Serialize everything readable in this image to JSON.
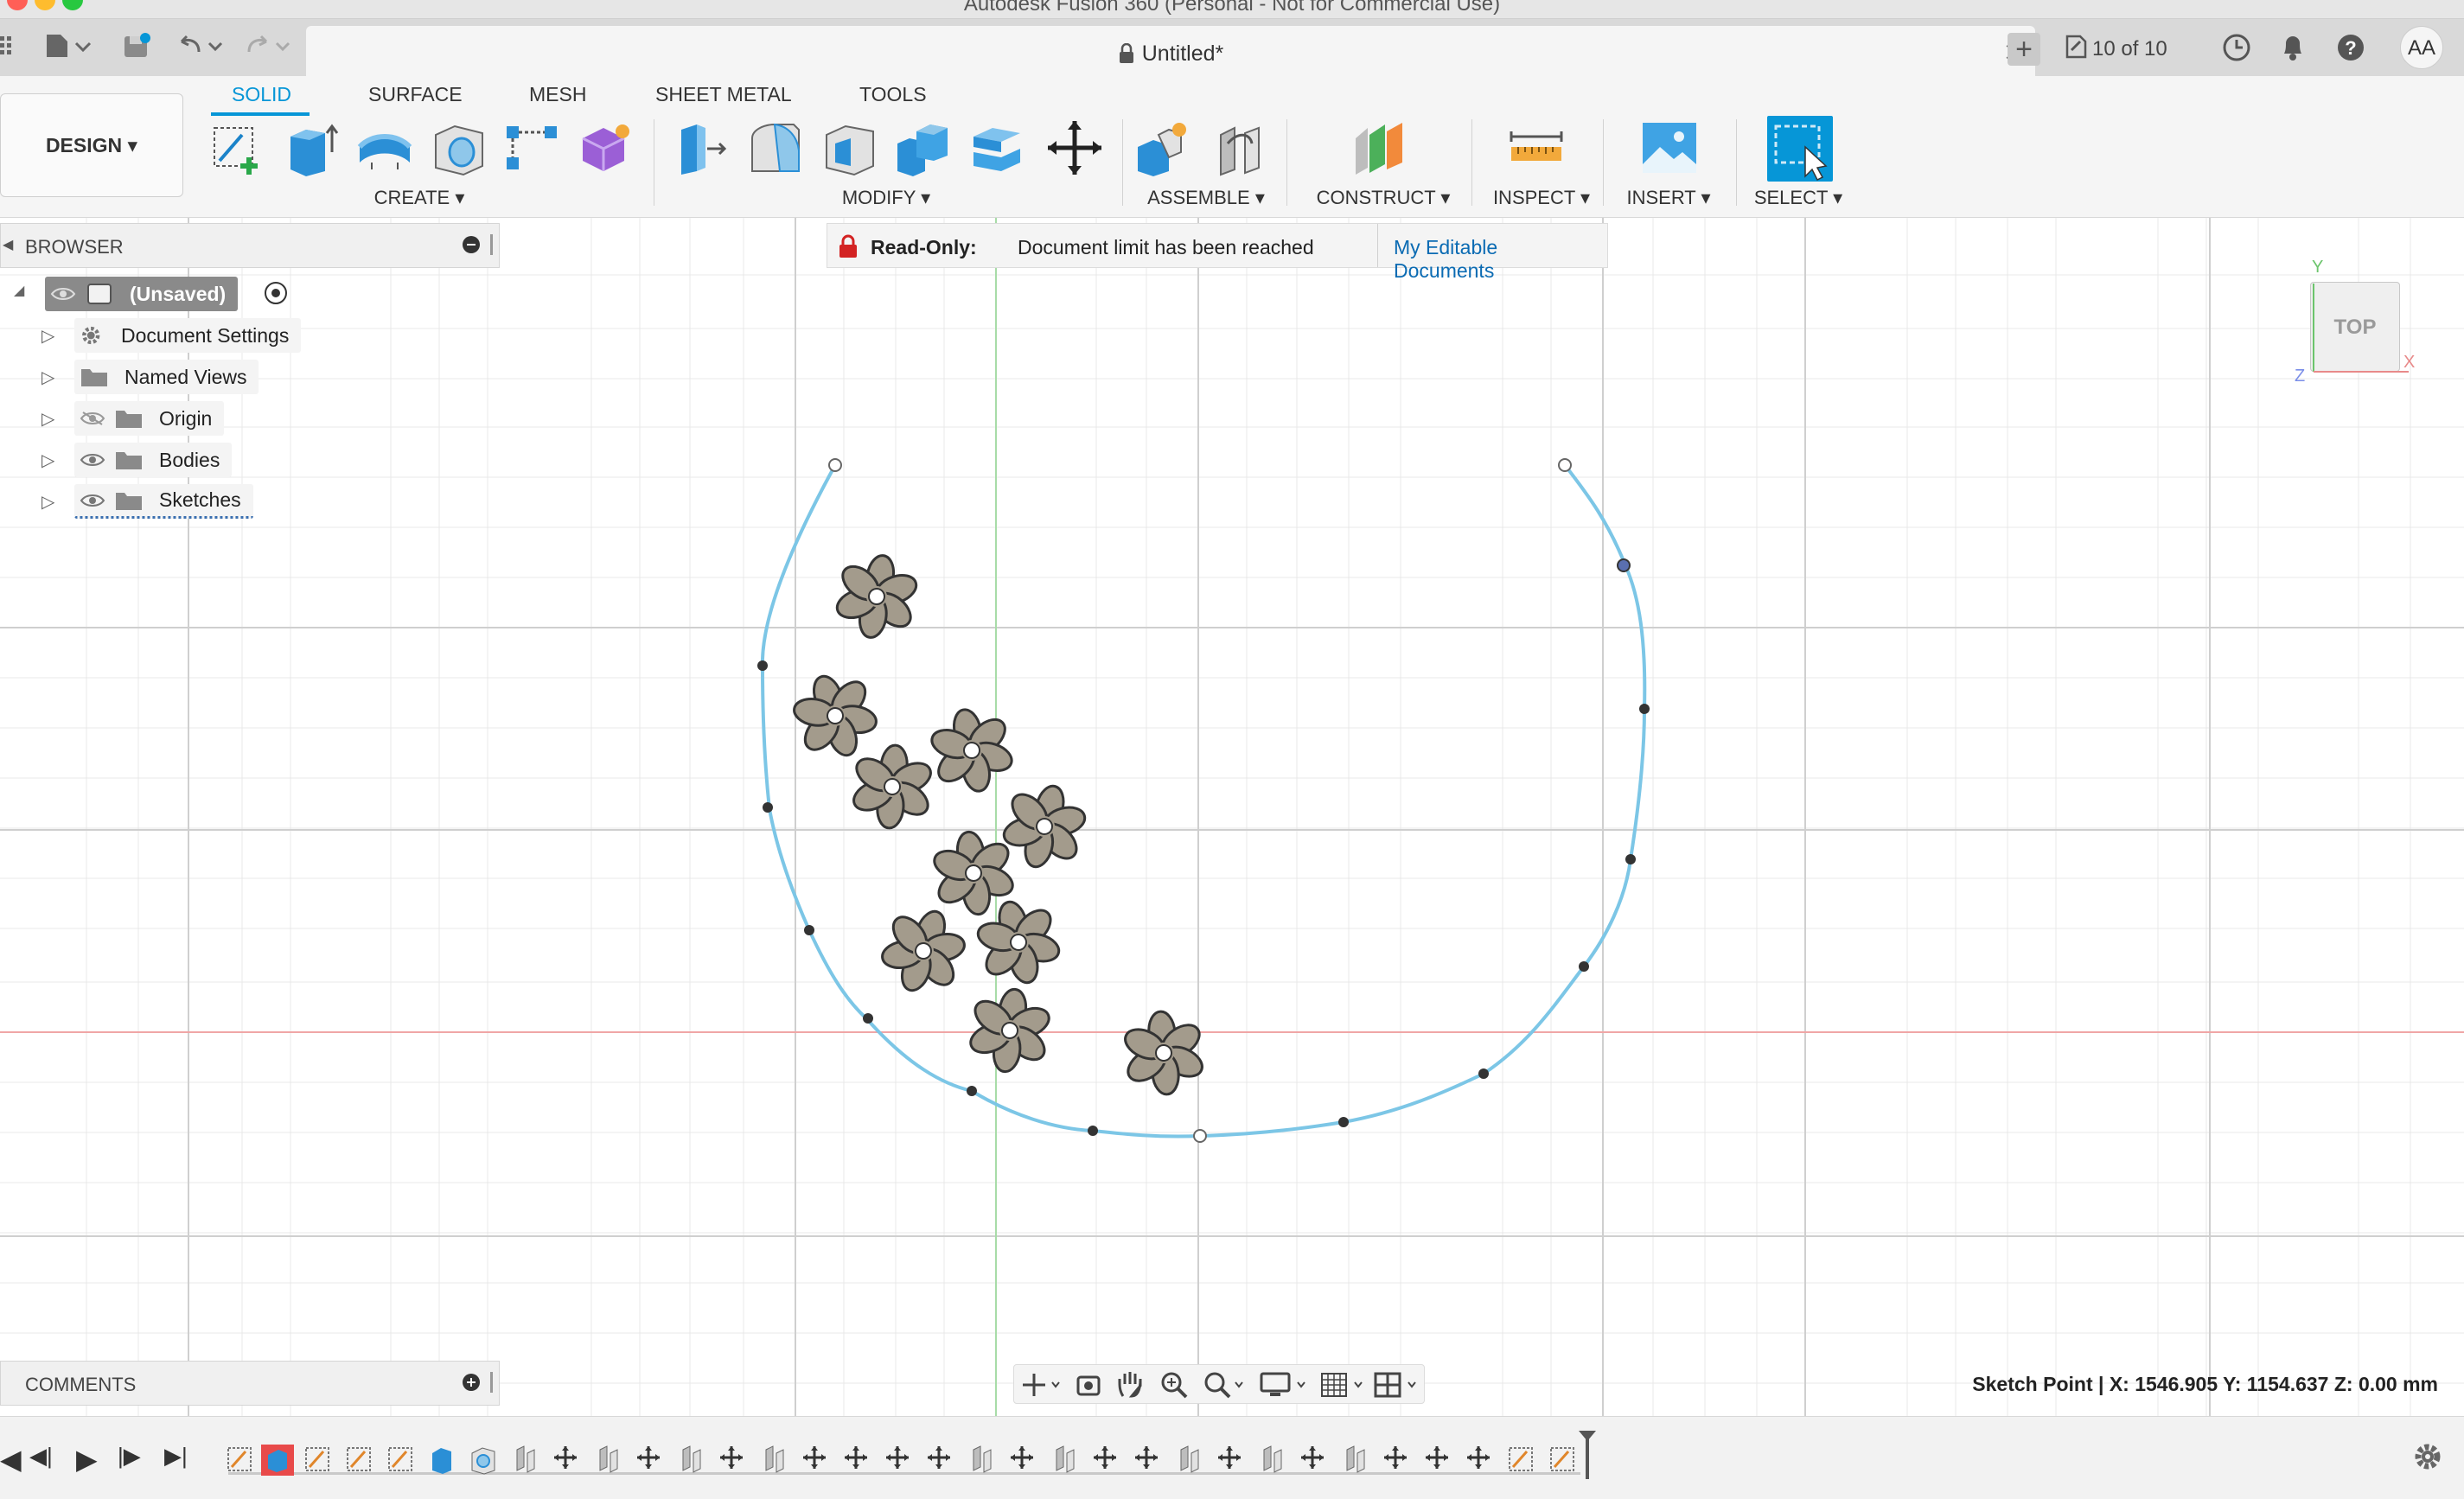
{
  "window": {
    "title": "Autodesk Fusion 360 (Personal - Not for Commercial Use)"
  },
  "tabbar": {
    "doc_title": "Untitled*",
    "job_status": "10 of 10",
    "user_initials": "AA"
  },
  "ribbon": {
    "workspace": "DESIGN ▾",
    "tabs": [
      "SOLID",
      "SURFACE",
      "MESH",
      "SHEET METAL",
      "TOOLS"
    ],
    "groups": [
      "CREATE ▾",
      "MODIFY ▾",
      "ASSEMBLE ▾",
      "CONSTRUCT ▾",
      "INSPECT ▾",
      "INSERT ▾",
      "SELECT ▾"
    ]
  },
  "browser": {
    "header": "BROWSER",
    "root": "(Unsaved)",
    "items": [
      "Document Settings",
      "Named Views",
      "Origin",
      "Bodies",
      "Sketches"
    ]
  },
  "banner": {
    "label": "Read-Only:",
    "message": "Document limit has been reached",
    "link": "My Editable Documents"
  },
  "viewcube": {
    "face": "TOP",
    "axes": [
      "Y",
      "X",
      "Z"
    ]
  },
  "comments": {
    "header": "COMMENTS"
  },
  "status": {
    "text": "Sketch Point | X: 1546.905 Y: 1154.637 Z: 0.00 mm"
  },
  "colors": {
    "accent": "#0696d7",
    "spline": "#7cc6e6",
    "flower": "#a39b8c",
    "axis_red": "#f0a6a6",
    "axis_green": "#a8dca8"
  },
  "icons": [
    "apps-grid-icon",
    "file-icon",
    "save-icon",
    "undo-icon",
    "redo-icon",
    "new-tab-icon",
    "job-status-icon",
    "clock-icon",
    "bell-icon",
    "help-icon",
    "lock-icon",
    "gear-icon"
  ]
}
